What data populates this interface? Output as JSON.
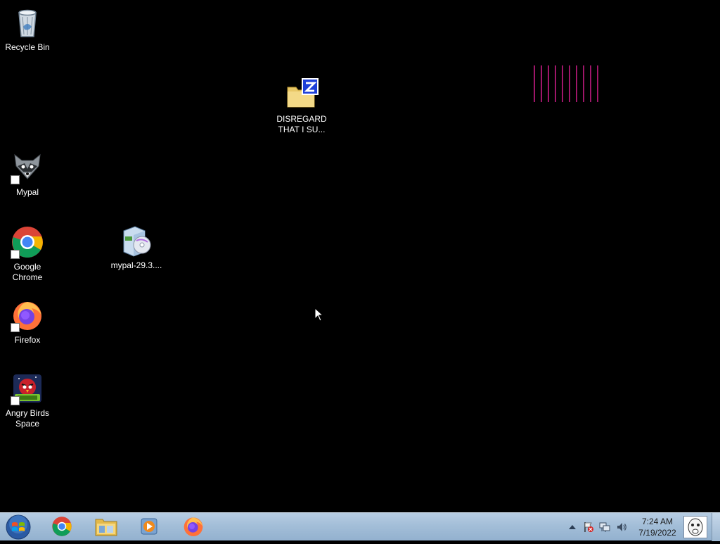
{
  "desktop": {
    "icons": [
      {
        "label": "Recycle Bin",
        "icon": "recycle-bin-icon"
      },
      {
        "label": "DISREGARD\nTHAT I SU...",
        "icon": "zip-folder-icon"
      },
      {
        "label": "Mypal",
        "icon": "mypal-icon",
        "shortcut": true
      },
      {
        "label": "mypal-29.3....",
        "icon": "installer-icon"
      },
      {
        "label": "Google\nChrome",
        "icon": "chrome-icon",
        "shortcut": true
      },
      {
        "label": "Firefox",
        "icon": "firefox-icon",
        "shortcut": true
      },
      {
        "label": "Angry Birds\nSpace",
        "icon": "angry-birds-space-icon",
        "shortcut": true
      }
    ],
    "background_color": "#000000",
    "accent_color": "#d21e8c"
  },
  "taskbar": {
    "start": {
      "icon": "windows-start-orb-icon"
    },
    "pinned": [
      {
        "name": "Google Chrome",
        "icon": "chrome-icon"
      },
      {
        "name": "Windows Explorer",
        "icon": "folder-icon"
      },
      {
        "name": "Windows Media Player",
        "icon": "media-player-icon"
      },
      {
        "name": "Firefox",
        "icon": "firefox-icon"
      }
    ],
    "tray": {
      "icons": [
        "show-hidden-icons-arrow",
        "action-center-flag-icon",
        "network-icon",
        "volume-icon"
      ],
      "time": "7:24 AM",
      "date": "7/19/2022"
    }
  }
}
